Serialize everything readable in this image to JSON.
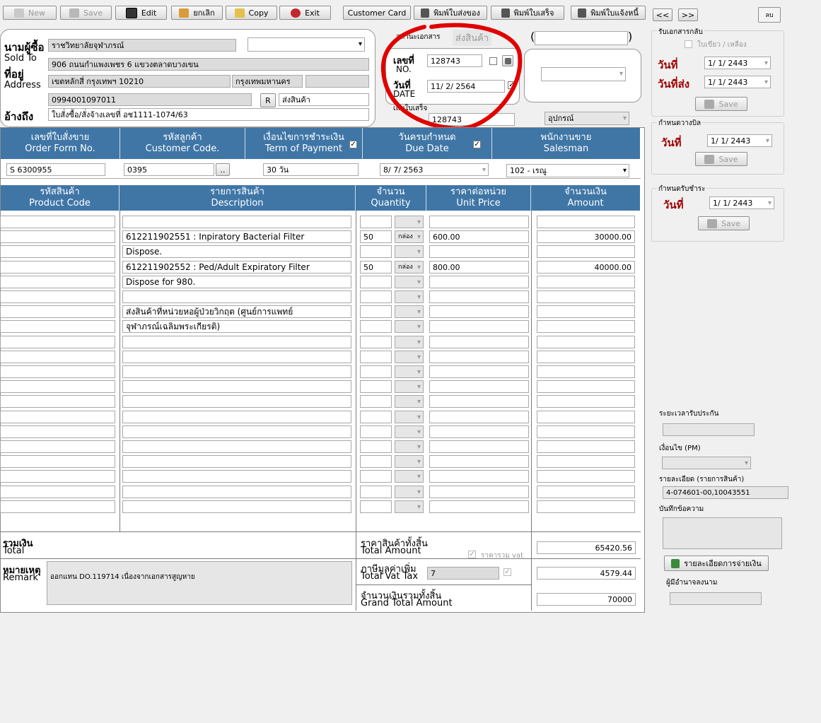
{
  "toolbar": {
    "new": "New",
    "save": "Save",
    "edit": "Edit",
    "cancel": "ยกเลิก",
    "copy": "Copy",
    "exit": "Exit",
    "customer_card": "Customer Card",
    "print_delivery": "พิมพ์ใบส่งของ",
    "print_receipt": "พิมพ์ใบเสร็จ",
    "print_notice": "พิมพ์ใบแจ้งหนี้",
    "prev": "<<",
    "next": ">>",
    "delete": "ลบ"
  },
  "buyer": {
    "label_th": "นามผู้ซื้อ",
    "label_sold_to": "Sold To",
    "label_address_th": "ที่อยู่",
    "label_address": "Address",
    "label_ref": "อ้างถึง",
    "name": "ราชวิทยาลัยจุฬาภรณ์",
    "address1": "906 ถนนกำแพงเพชร 6 แขวงตลาดบางเขน",
    "address2": "เขตหลักสี่ กรุงเทพฯ 10210",
    "province": "กรุงเทพมหานคร",
    "tax_id": "0994001097011",
    "r_button": "R",
    "ship_label": "ส่งสินค้า",
    "reference": "ใบสั่งซื้อ/สั่งจ้างเลขที่ อช1111-1074/63"
  },
  "doc": {
    "status_label": "สถานะเอกสาร",
    "status_value": "ส่งสินค้า",
    "no_label_th": "เลขที่",
    "no_label": "NO.",
    "number": "128743",
    "date_label_th": "วันที่",
    "date_label": "DATE",
    "date": "11/ 2/ 2564",
    "tax_no_label": "เลขใบเสร็จ",
    "tax_no": "128743",
    "category": "อุปกรณ์"
  },
  "order": {
    "headers": [
      {
        "th": "เลขที่ใบสั่งขาย",
        "en": "Order Form No."
      },
      {
        "th": "รหัสลูกค้า",
        "en": "Customer Code."
      },
      {
        "th": "เงื่อนไขการชำระเงิน",
        "en": "Term of Payment"
      },
      {
        "th": "วันครบกำหนด",
        "en": "Due Date"
      },
      {
        "th": "พนักงานขาย",
        "en": "Salesman"
      }
    ],
    "order_no": "S 6300955",
    "customer_code": "0395",
    "term": "30 วัน",
    "due_date": "8/ 7/ 2563",
    "salesman": "102 - เรณู",
    "dots": ".."
  },
  "items": {
    "headers": [
      {
        "th": "รหัสสินค้า",
        "en": "Product Code"
      },
      {
        "th": "รายการสินค้า",
        "en": "Description"
      },
      {
        "th": "จำนวน",
        "en": "Quantity"
      },
      {
        "th": "ราคาต่อหน่วย",
        "en": "Unit Price"
      },
      {
        "th": "จำนวนเงิน",
        "en": "Amount"
      }
    ],
    "rows": [
      {
        "code": "",
        "desc": "",
        "qty": "",
        "unit": "",
        "price": "",
        "amount": ""
      },
      {
        "code": "",
        "desc": "612211902551 : Inpiratory Bacterial Filter",
        "qty": "50",
        "unit": "กล่อง",
        "price": "600.00",
        "amount": "30000.00"
      },
      {
        "code": "",
        "desc": "Dispose.",
        "qty": "",
        "unit": "",
        "price": "",
        "amount": ""
      },
      {
        "code": "",
        "desc": "612211902552 : Ped/Adult Expiratory Filter",
        "qty": "50",
        "unit": "กล่อง",
        "price": "800.00",
        "amount": "40000.00"
      },
      {
        "code": "",
        "desc": "Dispose for 980.",
        "qty": "",
        "unit": "",
        "price": "",
        "amount": ""
      },
      {
        "code": "",
        "desc": "",
        "qty": "",
        "unit": "",
        "price": "",
        "amount": ""
      },
      {
        "code": "",
        "desc": "ส่งสินค้าที่หน่วยหอผู้ป่วยวิกฤต (ศูนย์การแพทย์",
        "qty": "",
        "unit": "",
        "price": "",
        "amount": ""
      },
      {
        "code": "",
        "desc": "จุฬาภรณ์เฉลิมพระเกียรติ)",
        "qty": "",
        "unit": "",
        "price": "",
        "amount": ""
      },
      {
        "code": "",
        "desc": "",
        "qty": "",
        "unit": "",
        "price": "",
        "amount": ""
      },
      {
        "code": "",
        "desc": "",
        "qty": "",
        "unit": "",
        "price": "",
        "amount": ""
      },
      {
        "code": "",
        "desc": "",
        "qty": "",
        "unit": "",
        "price": "",
        "amount": ""
      },
      {
        "code": "",
        "desc": "",
        "qty": "",
        "unit": "",
        "price": "",
        "amount": ""
      },
      {
        "code": "",
        "desc": "",
        "qty": "",
        "unit": "",
        "price": "",
        "amount": ""
      },
      {
        "code": "",
        "desc": "",
        "qty": "",
        "unit": "",
        "price": "",
        "amount": ""
      },
      {
        "code": "",
        "desc": "",
        "qty": "",
        "unit": "",
        "price": "",
        "amount": ""
      },
      {
        "code": "",
        "desc": "",
        "qty": "",
        "unit": "",
        "price": "",
        "amount": ""
      },
      {
        "code": "",
        "desc": "",
        "qty": "",
        "unit": "",
        "price": "",
        "amount": ""
      },
      {
        "code": "",
        "desc": "",
        "qty": "",
        "unit": "",
        "price": "",
        "amount": ""
      },
      {
        "code": "",
        "desc": "",
        "qty": "",
        "unit": "",
        "price": "",
        "amount": ""
      },
      {
        "code": "",
        "desc": "",
        "qty": "",
        "unit": "",
        "price": "",
        "amount": ""
      }
    ]
  },
  "totals": {
    "total_th": "รวมเงิน",
    "total_en": "Total",
    "remark_th": "หมายเหตุ",
    "remark_en": "Remark",
    "remark": "ออกแทน DO.119714 เนื่องจากเอกสารสูญหาย",
    "total_amount_th": "ราคาสินค้าทั้งสิ้น",
    "total_amount_en": "Total Amount",
    "vat_inc_label": "ราคารวม vat",
    "vat_th": "ภาษีมูลค่าเพิ่ม",
    "vat_en": "Total Vat Tax",
    "vat_rate": "7",
    "grand_th": "จำนวนเงินรวมทั้งสิ้น",
    "grand_en": "Grand Total Amount",
    "total_amount": "65420.56",
    "vat_amount": "4579.44",
    "grand_total": "70000"
  },
  "side": {
    "receive_group": "รับเอกสารกลับ",
    "receive_check": "ใบเขียว / เหลือง",
    "date_label": "วันที่",
    "send_label": "วันที่ส่ง",
    "receive_date": "1/ 1/ 2443",
    "send_date": "1/ 1/ 2443",
    "save": "Save",
    "bill_group": "กำหนดวางบิล",
    "bill_date": "1/ 1/ 2443",
    "pay_group": "กำหนดรับชำระ",
    "pay_date": "1/ 1/ 2443",
    "warranty_label": "ระยะเวลารับประกัน",
    "pm_label": "เงื่อนไข (PM)",
    "detail_label": "รายละเอียด (รายการสินค้า)",
    "detail_value": "4-074601-00,10043551",
    "note_label": "บันทึกข้อความ",
    "payment_button": "รายละเอียดการจ่ายเงิน",
    "approver_label": "ผู้มีอำนาจลงนาม"
  },
  "colors": {
    "header_blue": "#3f76a6",
    "red_label": "#a00000",
    "annotation": "#e00000"
  }
}
